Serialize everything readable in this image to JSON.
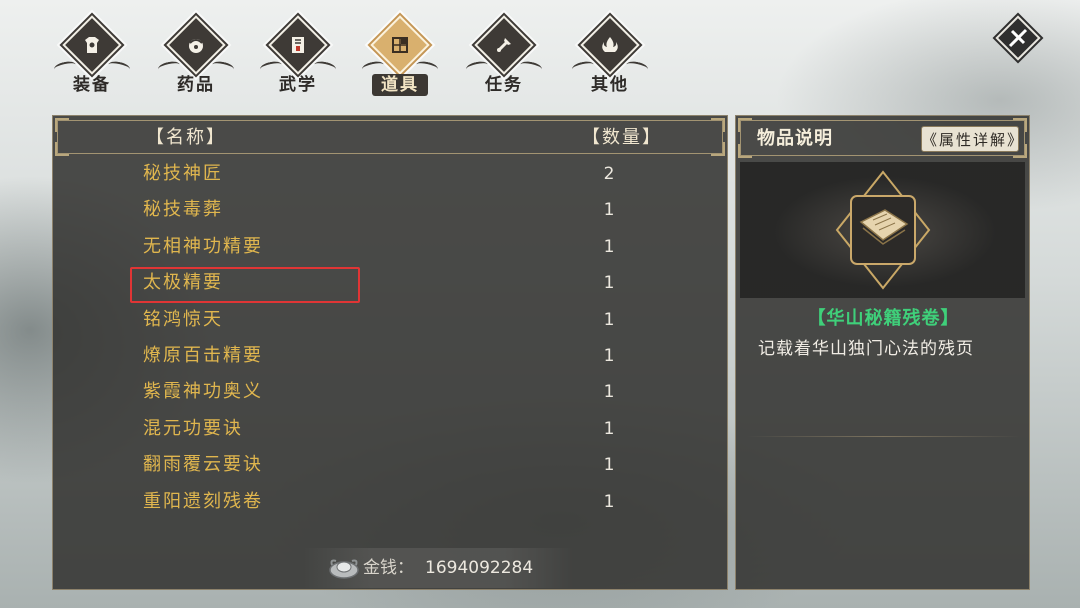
{
  "tabs": [
    {
      "label": "装备",
      "icon": "armor-icon",
      "active": false
    },
    {
      "label": "药品",
      "icon": "medicine-icon",
      "active": false
    },
    {
      "label": "武学",
      "icon": "martial-book-icon",
      "active": false
    },
    {
      "label": "道具",
      "icon": "item-scroll-icon",
      "active": true
    },
    {
      "label": "任务",
      "icon": "quest-icon",
      "active": false
    },
    {
      "label": "其他",
      "icon": "flame-icon",
      "active": false
    }
  ],
  "list": {
    "header_name": "【名称】",
    "header_qty": "【数量】",
    "items": [
      {
        "name": "秘技神匠",
        "qty": "2"
      },
      {
        "name": "秘技毒葬",
        "qty": "1"
      },
      {
        "name": "无相神功精要",
        "qty": "1"
      },
      {
        "name": "太极精要",
        "qty": "1"
      },
      {
        "name": "铭鸿惊天",
        "qty": "1"
      },
      {
        "name": "燎原百击精要",
        "qty": "1"
      },
      {
        "name": "紫霞神功奥义",
        "qty": "1"
      },
      {
        "name": "混元功要诀",
        "qty": "1"
      },
      {
        "name": "翻雨覆云要诀",
        "qty": "1"
      },
      {
        "name": "重阳遗刻残卷",
        "qty": "1"
      }
    ],
    "selected_index": 3
  },
  "money": {
    "label": "金钱：",
    "value": "1694092284"
  },
  "detail": {
    "title": "物品说明",
    "attr_button": "《属性详解》",
    "item_name": "【华山秘籍残卷】",
    "item_desc": "记载着华山独门心法的残页"
  },
  "colors": {
    "item_name": "#e0b64e",
    "highlight": "#e03535",
    "rarity_green": "#3fd07a",
    "active_tab": "#d9b06e"
  }
}
